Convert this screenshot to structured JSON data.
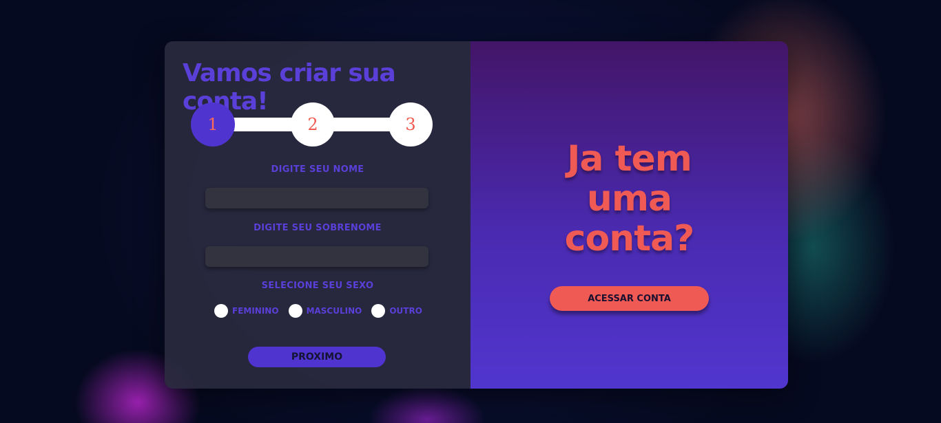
{
  "form": {
    "title": "Vamos criar sua conta!",
    "steps": [
      "1",
      "2",
      "3"
    ],
    "active_step": 1,
    "first_name_label": "DIGITE SEU NOME",
    "first_name_value": "",
    "last_name_label": "DIGITE SEU SOBRENOME",
    "last_name_value": "",
    "gender_label": "SELECIONE SEU SEXO",
    "gender_options": [
      "FEMININO",
      "MASCULINO",
      "OUTRO"
    ],
    "next_button": "PROXIMO"
  },
  "side": {
    "title": "Ja tem uma conta?",
    "login_button": "ACESSAR CONTA"
  },
  "colors": {
    "accent": "#5034d0",
    "coral": "#f05a55",
    "panel": "#2a2a3e"
  }
}
